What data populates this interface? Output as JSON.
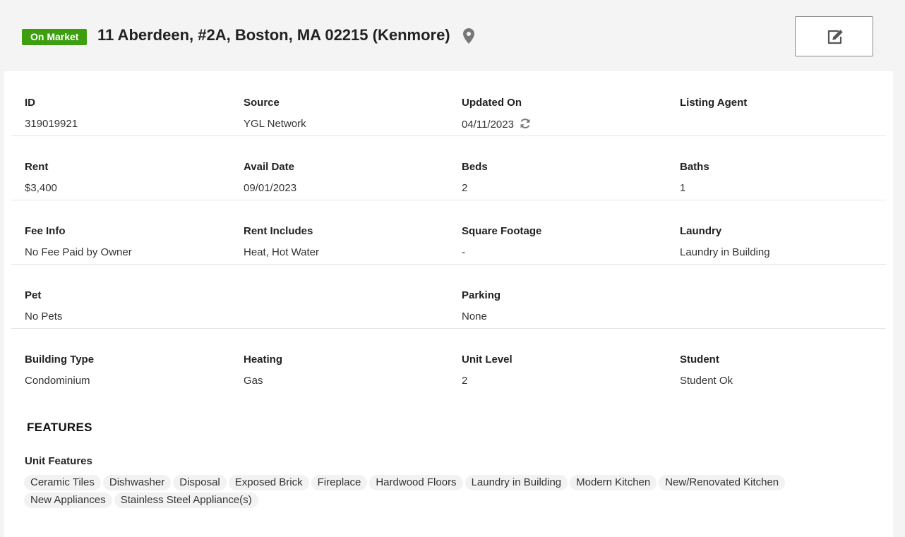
{
  "header": {
    "status_badge": "On Market",
    "address": "11 Aberdeen, #2A, Boston, MA 02215 (Kenmore)",
    "badge_color": "#3d9f10"
  },
  "rows": [
    [
      {
        "label": "ID",
        "value": "319019921"
      },
      {
        "label": "Source",
        "value": "YGL Network"
      },
      {
        "label": "Updated On",
        "value": "04/11/2023"
      },
      {
        "label": "Listing Agent",
        "value": ""
      }
    ],
    [
      {
        "label": "Rent",
        "value": "$3,400"
      },
      {
        "label": "Avail Date",
        "value": "09/01/2023"
      },
      {
        "label": "Beds",
        "value": "2"
      },
      {
        "label": "Baths",
        "value": "1"
      }
    ],
    [
      {
        "label": "Fee Info",
        "value": "No Fee Paid by Owner"
      },
      {
        "label": "Rent Includes",
        "value": "Heat, Hot Water"
      },
      {
        "label": "Square Footage",
        "value": "-"
      },
      {
        "label": "Laundry",
        "value": "Laundry in Building"
      }
    ],
    [
      {
        "label": "Pet",
        "value": "No Pets"
      },
      {
        "label": "",
        "value": ""
      },
      {
        "label": "Parking",
        "value": "None"
      },
      {
        "label": "",
        "value": ""
      }
    ],
    [
      {
        "label": "Building Type",
        "value": "Condominium"
      },
      {
        "label": "Heating",
        "value": "Gas"
      },
      {
        "label": "Unit Level",
        "value": "2"
      },
      {
        "label": "Student",
        "value": "Student Ok"
      }
    ]
  ],
  "features": {
    "title": "FEATURES",
    "unit_features_label": "Unit Features",
    "unit_features": [
      "Ceramic Tiles",
      "Dishwasher",
      "Disposal",
      "Exposed Brick",
      "Fireplace",
      "Hardwood Floors",
      "Laundry in Building",
      "Modern Kitchen",
      "New/Renovated Kitchen",
      "New Appliances",
      "Stainless Steel Appliance(s)"
    ]
  }
}
